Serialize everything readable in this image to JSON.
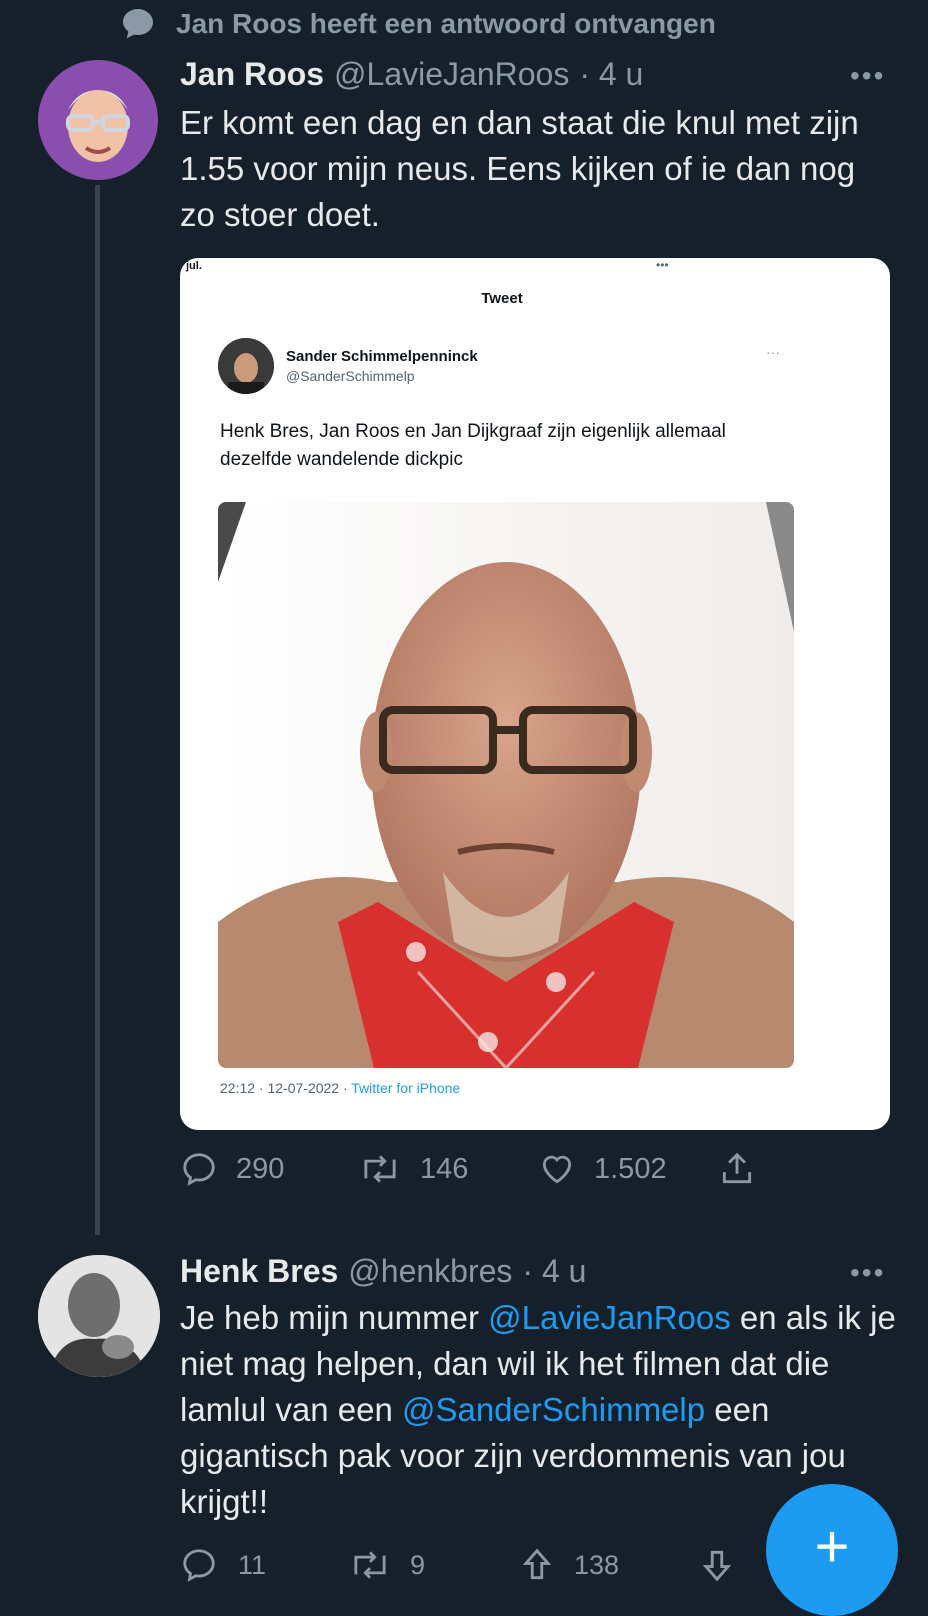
{
  "social_context": {
    "label": "Jan Roos heeft een antwoord ontvangen",
    "icon": "speech-bubble-icon"
  },
  "tweet1": {
    "name": "Jan Roos",
    "handle": "@LavieJanRoos",
    "time": "· 4 u",
    "more": "•••",
    "text": "Er komt een dag en dan staat die knul met zijn 1.55 voor mijn neus. Eens kijken of ie dan nog zo stoer doet.",
    "actions": {
      "replies": "290",
      "retweets": "146",
      "likes": "1.502"
    }
  },
  "embedded": {
    "top_left": "jul.",
    "top_dots": "•••",
    "header": "Tweet",
    "author_name": "Sander Schimmelpenninck",
    "author_handle": "@SanderSchimmelp",
    "dots": "···",
    "text_line1": "Henk Bres, Jan Roos en Jan Dijkgraaf zijn eigenlijk allemaal",
    "text_line2": "dezelfde wandelende dickpic",
    "footer_time": "22:12 · 12-07-2022 · ",
    "footer_source": "Twitter for iPhone"
  },
  "tweet2": {
    "name": "Henk Bres",
    "handle": "@henkbres",
    "time": "· 4 u",
    "more": "•••",
    "text_parts": {
      "p1": "Je heb mijn nummer ",
      "m1": "@LavieJanRoos",
      "p2": " en als ik je niet mag helpen, dan wil ik het filmen dat die lamlul van een ",
      "m2": "@SanderSchimmelp",
      "p3": " een gigantisch pak voor zijn verdommenis van jou krijgt!!"
    },
    "actions": {
      "replies": "11",
      "retweets": "9",
      "upvotes": "138"
    }
  },
  "fab": {
    "label": "+"
  },
  "colors": {
    "background": "#15202b",
    "accent": "#1d9bf0",
    "muted": "#8b98a5",
    "text": "#e7e9ea"
  }
}
